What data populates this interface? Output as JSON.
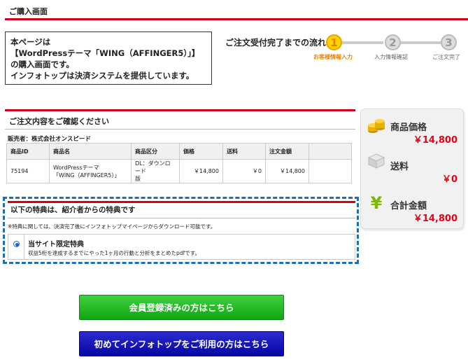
{
  "header": {
    "title": "ご購入画面"
  },
  "intro": {
    "lines": [
      "本ページは",
      "【WordPressテーマ「WING（AFFINGER5）」】",
      "の購入画面です。",
      "インフォトップは決済システムを提供しています。"
    ]
  },
  "steps": {
    "title": "ご注文受付完了までの流れ",
    "items": [
      {
        "num": "1",
        "label": "お客様情報入力"
      },
      {
        "num": "2",
        "label": "入力情報確認"
      },
      {
        "num": "3",
        "label": "ご注文完了"
      }
    ],
    "active_color": "#f08300"
  },
  "order": {
    "title": "ご注文内容をご確認ください",
    "seller": "販売者：株式会社オンスピード",
    "columns": [
      "商品ID",
      "商品名",
      "商品区分",
      "価格",
      "送料",
      "注文金額",
      ""
    ],
    "row": {
      "id": "75194",
      "name_line1": "WordPressテーマ",
      "name_line2": "「WING（AFFINGER5）」",
      "category_line1": "DL：ダウンロード",
      "category_line2": "版",
      "price": "￥14,800",
      "shipping": "￥0",
      "total": "￥14,800"
    }
  },
  "bonus": {
    "title": "以下の特典は、紹介者からの特典です",
    "note": "※特典に関しては、決済完了後にインフォトップマイページからダウンロード可能です。",
    "item_title": "当サイト限定特典",
    "item_desc": "収益5桁を達成するまでにやった1ヶ月の行動と分析をまとめたpdfです。"
  },
  "summary": {
    "product_label": "商品価格",
    "product_value": "￥14,800",
    "shipping_label": "送料",
    "shipping_value": "￥0",
    "total_label": "合計金額",
    "total_value": "￥14,800",
    "value_color": "#e60012"
  },
  "buttons": {
    "member": "会員登録済みの方はこちら",
    "first_time": "初めてインフォトップをご利用の方はこちら"
  },
  "colors": {
    "accent_red": "#d0021b",
    "green": "#1cb51c",
    "blue": "#0b0bb0",
    "dash_blue": "#1f6fb5"
  }
}
